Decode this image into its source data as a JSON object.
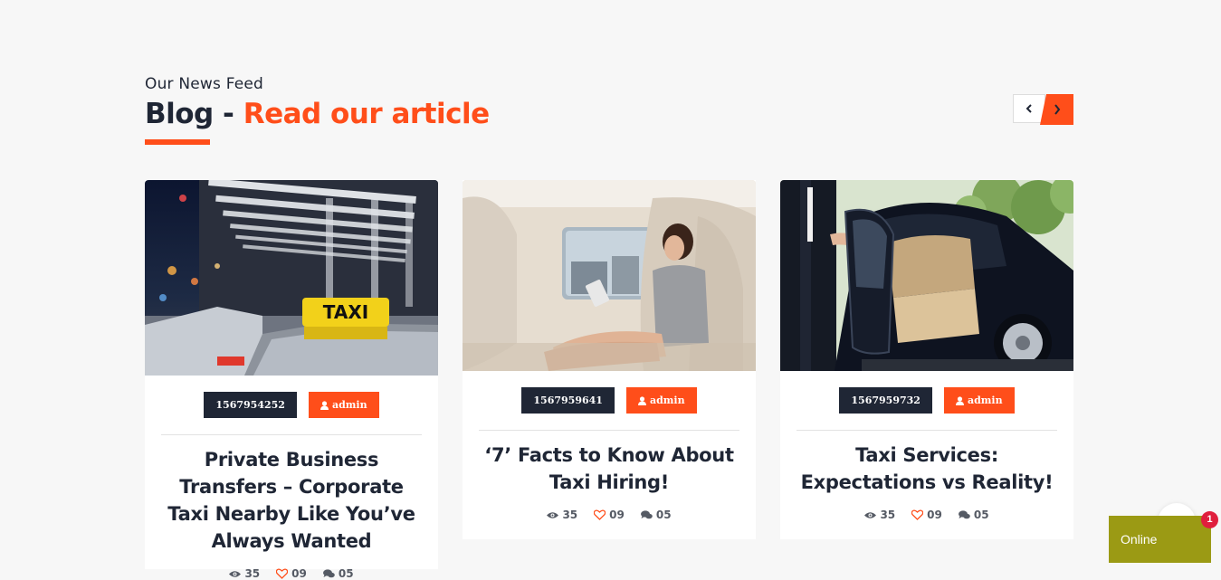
{
  "section": {
    "subtitle": "Our News Feed",
    "title_prefix": "Blog - ",
    "title_accent": "Read our article"
  },
  "navigation": {
    "prev_icon": "chevron-left-icon",
    "next_icon": "chevron-right-icon"
  },
  "posts": [
    {
      "id_badge": "1567954252",
      "author": "admin",
      "title": "Private Business Transfers – Corporate Taxi Nearby Like You’ve Always Wanted",
      "image": "taxi-sign-photo",
      "views": "35",
      "likes": "09",
      "comments": "05"
    },
    {
      "id_badge": "1567959641",
      "author": "admin",
      "title": "‘7’ Facts to Know About Taxi Hiring!",
      "image": "woman-in-car-photo",
      "views": "35",
      "likes": "09",
      "comments": "05"
    },
    {
      "id_badge": "1567959732",
      "author": "admin",
      "title": "Taxi Services: Expectations vs Reality!",
      "image": "chauffeur-car-photo",
      "views": "35",
      "likes": "09",
      "comments": "05"
    }
  ],
  "chat": {
    "status": "Online",
    "notification_count": "1"
  },
  "colors": {
    "accent": "#ff4e1a",
    "dark": "#1f2635",
    "online": "#9b9a14",
    "notification": "#e01f3d"
  }
}
